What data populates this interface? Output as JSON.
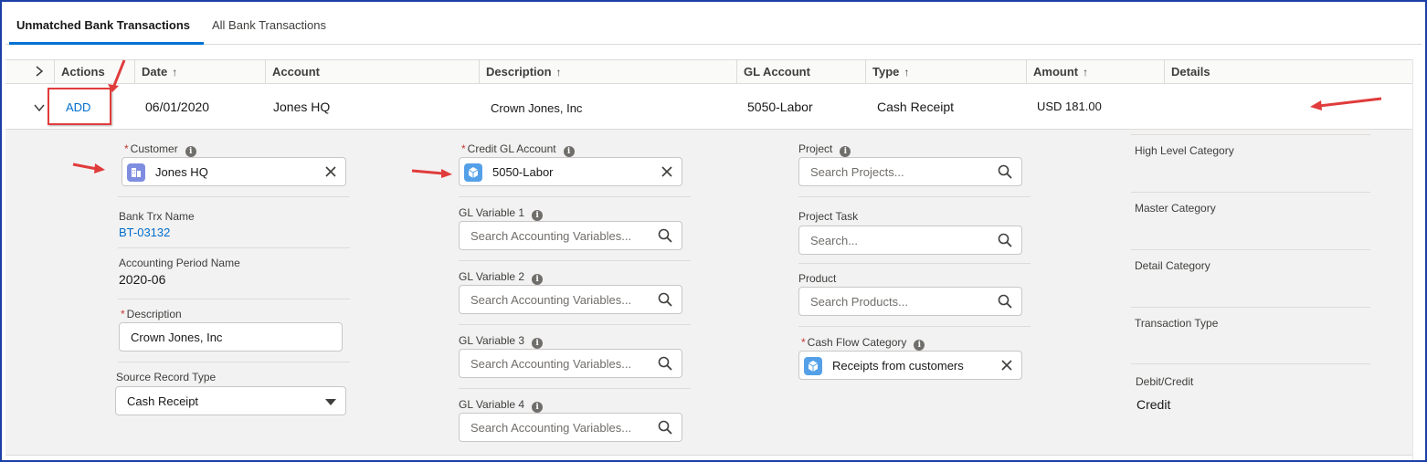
{
  "tabs": [
    {
      "label": "Unmatched Bank Transactions",
      "active": true
    },
    {
      "label": "All Bank Transactions",
      "active": false
    }
  ],
  "table": {
    "headers": {
      "actions": "Actions",
      "date": "Date",
      "account": "Account",
      "description": "Description",
      "gl_account": "GL Account",
      "type": "Type",
      "amount": "Amount",
      "details": "Details"
    },
    "sort_arrow": "↑",
    "row": {
      "action": "ADD",
      "date": "06/01/2020",
      "account": "Jones HQ",
      "description": "Crown Jones, Inc",
      "gl_account": "5050-Labor",
      "type": "Cash Receipt",
      "amount": "USD 181.00",
      "details": ""
    }
  },
  "form": {
    "customer": {
      "label": "Customer",
      "required": true,
      "value": "Jones HQ"
    },
    "bank_trx_name": {
      "label": "Bank Trx Name",
      "value": "BT-03132"
    },
    "accounting_period_name": {
      "label": "Accounting Period Name",
      "value": "2020-06"
    },
    "description": {
      "label": "Description",
      "required": true,
      "value": "Crown Jones, Inc"
    },
    "source_record_type": {
      "label": "Source Record Type",
      "value": "Cash Receipt"
    },
    "credit_gl_account": {
      "label": "Credit GL Account",
      "required": true,
      "value": "5050-Labor"
    },
    "gl_variable_1": {
      "label": "GL Variable 1",
      "placeholder": "Search Accounting Variables..."
    },
    "gl_variable_2": {
      "label": "GL Variable 2",
      "placeholder": "Search Accounting Variables..."
    },
    "gl_variable_3": {
      "label": "GL Variable 3",
      "placeholder": "Search Accounting Variables..."
    },
    "gl_variable_4": {
      "label": "GL Variable 4",
      "placeholder": "Search Accounting Variables..."
    },
    "project": {
      "label": "Project",
      "placeholder": "Search Projects..."
    },
    "project_task": {
      "label": "Project Task",
      "placeholder": "Search..."
    },
    "product": {
      "label": "Product",
      "placeholder": "Search Products..."
    },
    "cash_flow_category": {
      "label": "Cash Flow Category",
      "required": true,
      "value": "Receipts from customers"
    },
    "high_level_category": {
      "label": "High Level Category",
      "value": ""
    },
    "master_category": {
      "label": "Master Category",
      "value": ""
    },
    "detail_category": {
      "label": "Detail Category",
      "value": ""
    },
    "transaction_type": {
      "label": "Transaction Type",
      "value": ""
    },
    "debit_credit": {
      "label": "Debit/Credit",
      "value": "Credit"
    }
  },
  "icons": {
    "info": "i",
    "required_marker": "*"
  },
  "colors": {
    "accent": "#0070d2",
    "link": "#006dcc",
    "annotation_red": "#e03c3c",
    "account_icon": "#7f8de1",
    "gl_icon": "#54a0e8"
  }
}
